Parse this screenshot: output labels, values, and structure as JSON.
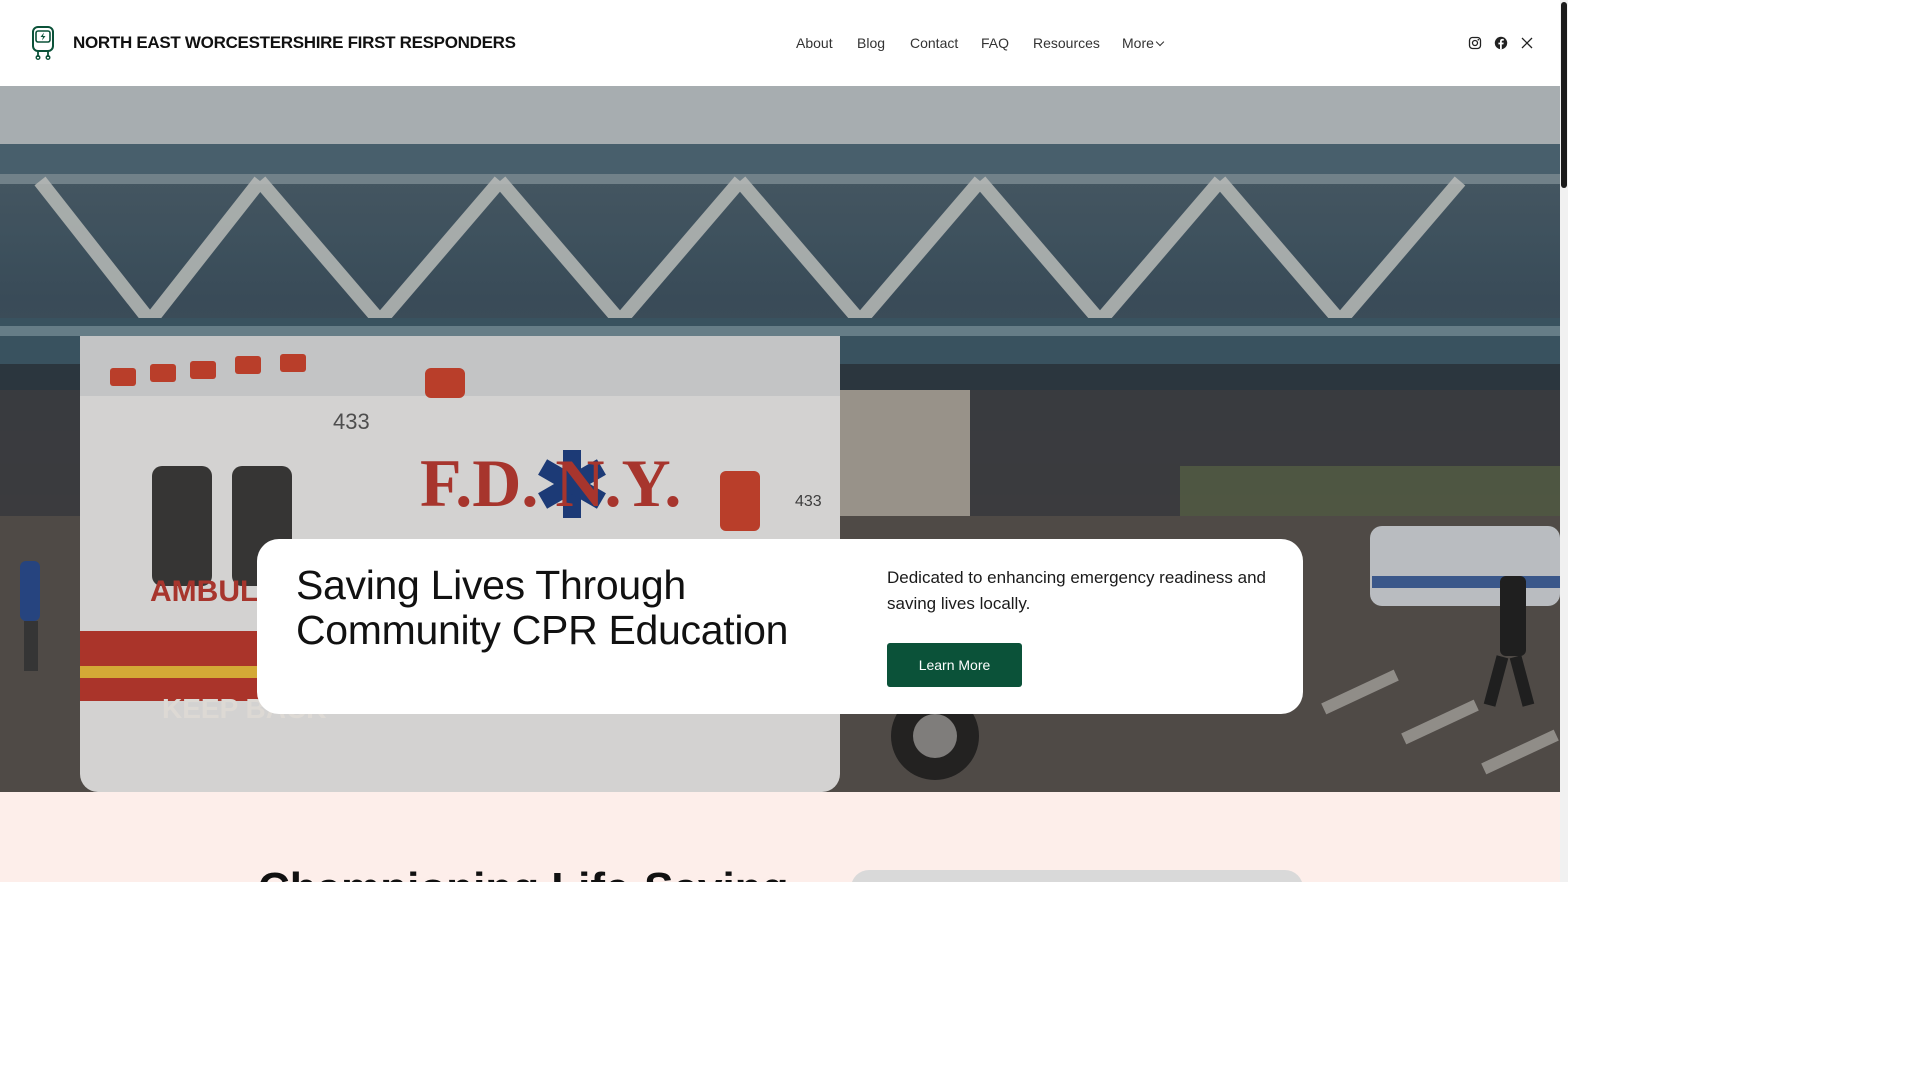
{
  "header": {
    "logo_icon": "defibrillator-icon",
    "site_title": "NORTH EAST WORCESTERSHIRE FIRST RESPONDERS",
    "nav": [
      {
        "label": "About"
      },
      {
        "label": "Blog"
      },
      {
        "label": "Contact"
      },
      {
        "label": "FAQ"
      },
      {
        "label": "Resources"
      },
      {
        "label": "More"
      }
    ],
    "social": [
      {
        "icon": "instagram-icon"
      },
      {
        "icon": "facebook-icon"
      },
      {
        "icon": "x-icon"
      }
    ]
  },
  "hero": {
    "title": "Saving Lives Through Community CPR Education",
    "description": "Dedicated to enhancing emergency readiness and saving lives locally.",
    "button_label": "Learn More",
    "image_text": {
      "fdny_side": "F.D. N.Y.",
      "unit_number": "433",
      "ambulance": "AMBULAN",
      "keep_back": "KEEP BACK"
    }
  },
  "section2": {
    "heading": "Championing Life-Saving"
  },
  "colors": {
    "button": "#0b5239",
    "section_bg": "#fdeeea",
    "card_bg": "#ffffff",
    "text": "#111111"
  }
}
